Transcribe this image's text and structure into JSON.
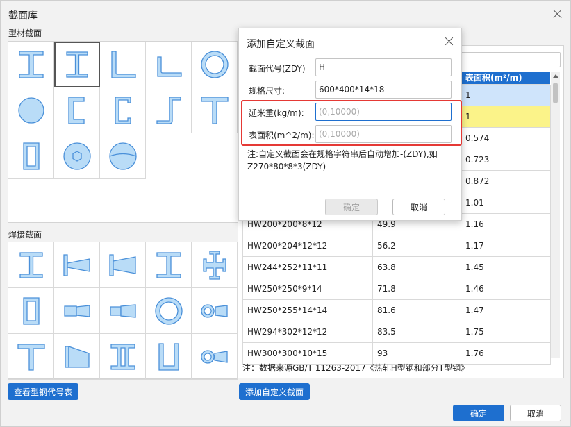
{
  "window": {
    "title": "截面库"
  },
  "sections": {
    "profile_label": "型材截面",
    "welded_label": "焊接截面"
  },
  "profile_shapes": [
    "i-beam-icon",
    "h-beam-icon",
    "angle-icon",
    "unequal-angle-icon",
    "ring-icon",
    "round-bar-icon",
    "channel-icon",
    "lipped-channel-icon",
    "z-section-icon",
    "t-section-icon",
    "rect-tube-icon",
    "hex-bar-icon",
    "split-circle-icon"
  ],
  "welded_shapes": [
    "welded-i-icon",
    "welded-tapered-i-icon",
    "welded-tapered-h-icon",
    "welded-h-icon",
    "welded-cross-icon",
    "welded-box-icon",
    "welded-box-tapered-icon",
    "welded-box-tapered-2-icon",
    "welded-ring-icon",
    "welded-ring-tapered-icon",
    "welded-t-icon",
    "welded-tapered-t-icon",
    "welded-double-i-icon",
    "welded-u-icon",
    "welded-ring-tapered-2-icon"
  ],
  "buttons": {
    "view_codes": "查看型钢代号表",
    "add_custom": "添加自定义截面",
    "ok": "确定",
    "cancel": "取消"
  },
  "table": {
    "headers": [
      "",
      "",
      "表面积(m²/m)"
    ],
    "rows": [
      [
        "",
        "",
        "1"
      ],
      [
        "",
        "",
        "1"
      ],
      [
        "",
        "",
        "0.574"
      ],
      [
        "",
        "",
        "0.723"
      ],
      [
        "",
        "",
        "0.872"
      ],
      [
        "",
        "",
        "1.01"
      ],
      [
        "HW200*200*8*12",
        "49.9",
        "1.16"
      ],
      [
        "HW200*204*12*12",
        "56.2",
        "1.17"
      ],
      [
        "HW244*252*11*11",
        "63.8",
        "1.45"
      ],
      [
        "HW250*250*9*14",
        "71.8",
        "1.46"
      ],
      [
        "HW250*255*14*14",
        "81.6",
        "1.47"
      ],
      [
        "HW294*302*12*12",
        "83.5",
        "1.75"
      ],
      [
        "HW300*300*10*15",
        "93",
        "1.76"
      ]
    ],
    "note": "注：数据来源GB/T 11263-2017《热轧H型钢和部分T型钢》"
  },
  "dialog": {
    "title": "添加自定义截面",
    "fields": {
      "code_label": "截面代号(ZDY)",
      "code_value": "H",
      "spec_label": "规格尺寸:",
      "spec_value": "600*400*14*18",
      "weight_label": "延米重(kg/m):",
      "weight_placeholder": "(0,10000)",
      "area_label": "表面积(m^2/m):",
      "area_placeholder": "(0,10000)"
    },
    "note": "注:自定义截面会在规格字符串后自动增加-(ZDY),如Z270*80*8*3(ZDY)",
    "ok": "确定",
    "cancel": "取消"
  },
  "colors": {
    "accent": "#1e6fcf",
    "shape_fill": "#b9dcf7",
    "shape_stroke": "#4a90d9",
    "highlight_row": "#fbf389",
    "selected_row": "#cfe4fb",
    "alert_border": "#e53935"
  }
}
